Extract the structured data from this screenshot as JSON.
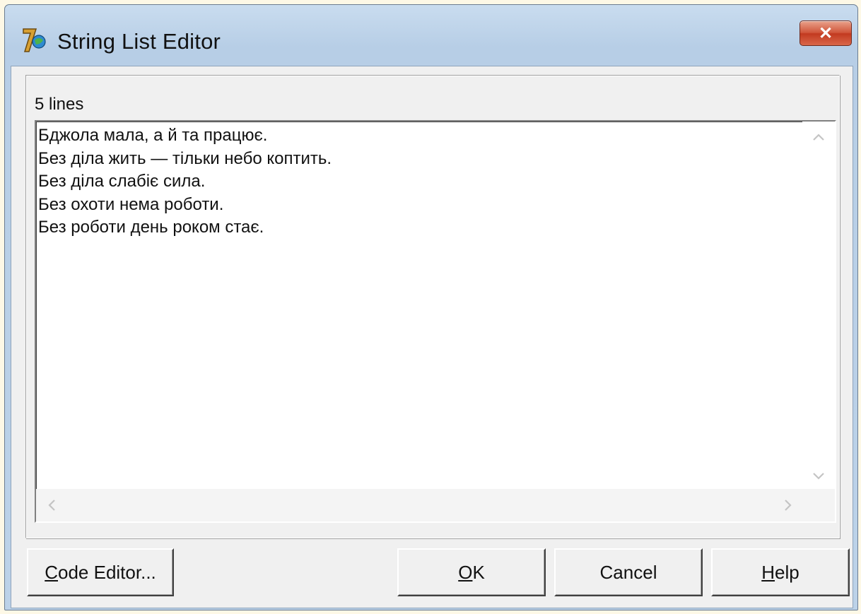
{
  "window": {
    "title": "String List Editor",
    "close_label": "✕"
  },
  "editor": {
    "line_count_label": "5 lines",
    "lines": [
      "Бджола мала, а й та працює.",
      "Без діла жить — тільки небо коптить.",
      "Без діла слабіє сила.",
      "Без охоти нема роботи.",
      "Без роботи день роком стає."
    ]
  },
  "buttons": {
    "code_editor": {
      "mnemonic": "C",
      "rest": "ode Editor..."
    },
    "ok": {
      "mnemonic": "O",
      "rest": "K"
    },
    "cancel": {
      "label": "Cancel"
    },
    "help": {
      "mnemonic": "H",
      "rest": "elp"
    }
  },
  "icons": {
    "app": "delphi-app-icon",
    "close": "close-icon",
    "scroll_up": "scroll-up-arrow-icon",
    "scroll_down": "scroll-down-arrow-icon",
    "scroll_left": "scroll-left-arrow-icon",
    "scroll_right": "scroll-right-arrow-icon"
  },
  "colors": {
    "close_button": "#c9472c",
    "title_bar": "#bcd2e8",
    "dialog_face": "#f0f0f0"
  }
}
